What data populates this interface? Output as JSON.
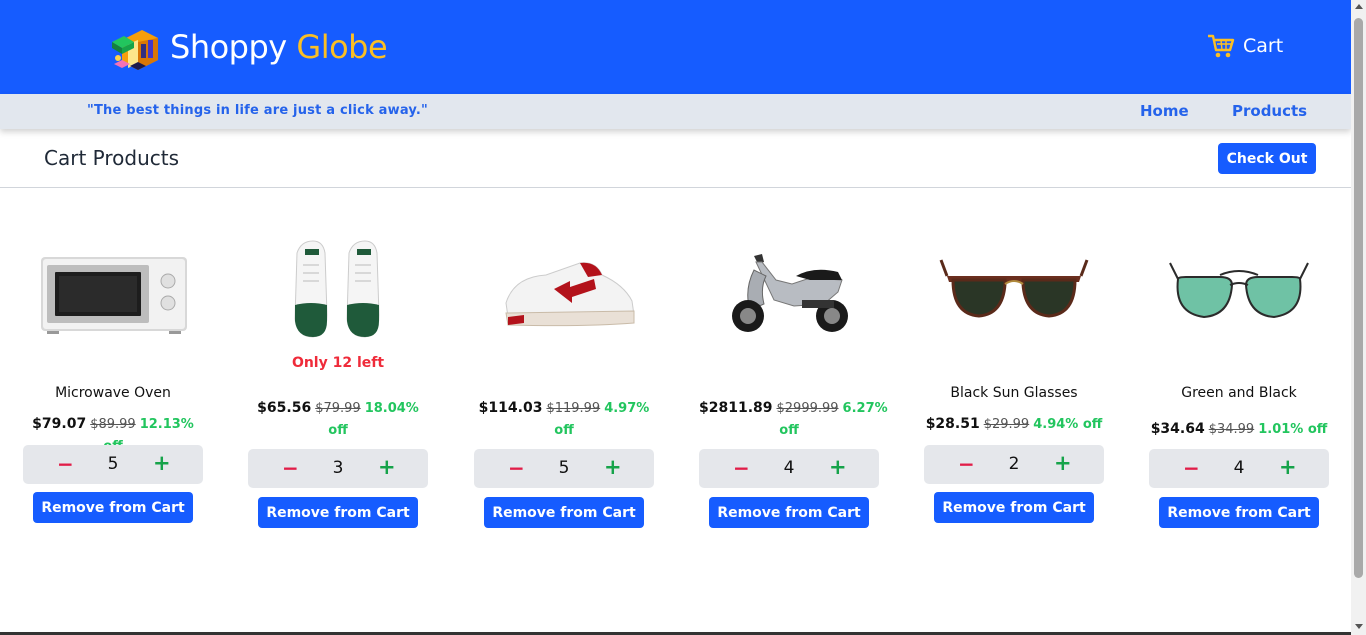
{
  "header": {
    "brand_primary": "Shoppy",
    "brand_accent": "Globe",
    "cart_label": "Cart",
    "tagline": "\"The best things in life are just a click away.\"",
    "nav": {
      "home": "Home",
      "products": "Products"
    }
  },
  "cart": {
    "title": "Cart Products",
    "checkout_label": "Check Out",
    "remove_label": "Remove from Cart",
    "minus_symbol": "−",
    "plus_symbol": "+",
    "items": [
      {
        "name": "Microwave Oven",
        "stock_note": "",
        "price": "$79.07",
        "original_price": "$89.99",
        "discount": "12.13% off",
        "quantity": "5",
        "image_icon": "microwave-image"
      },
      {
        "name": "",
        "stock_note": "Only 12 left",
        "price": "$65.56",
        "original_price": "$79.99",
        "discount": "18.04% off",
        "quantity": "3",
        "image_icon": "football-boots-image"
      },
      {
        "name": "",
        "stock_note": "",
        "price": "$114.03",
        "original_price": "$119.99",
        "discount": "4.97% off",
        "quantity": "5",
        "image_icon": "sneaker-image"
      },
      {
        "name": "",
        "stock_note": "",
        "price": "$2811.89",
        "original_price": "$2999.99",
        "discount": "6.27% off",
        "quantity": "4",
        "image_icon": "scooter-image"
      },
      {
        "name": "Black Sun Glasses",
        "stock_note": "",
        "price": "$28.51",
        "original_price": "$29.99",
        "discount": "4.94% off",
        "quantity": "2",
        "image_icon": "sunglasses-image"
      },
      {
        "name": "Green and Black",
        "stock_note": "",
        "price": "$34.64",
        "original_price": "$34.99",
        "discount": "1.01% off",
        "quantity": "4",
        "image_icon": "aviator-glasses-image"
      }
    ]
  },
  "colors": {
    "primary": "#165cff",
    "accent": "#fbbf24",
    "subbar": "#e2e7ee",
    "discount": "#22c55e",
    "stock_warning": "#ef2b3a",
    "minus": "#e11d48",
    "plus": "#16a34a"
  }
}
